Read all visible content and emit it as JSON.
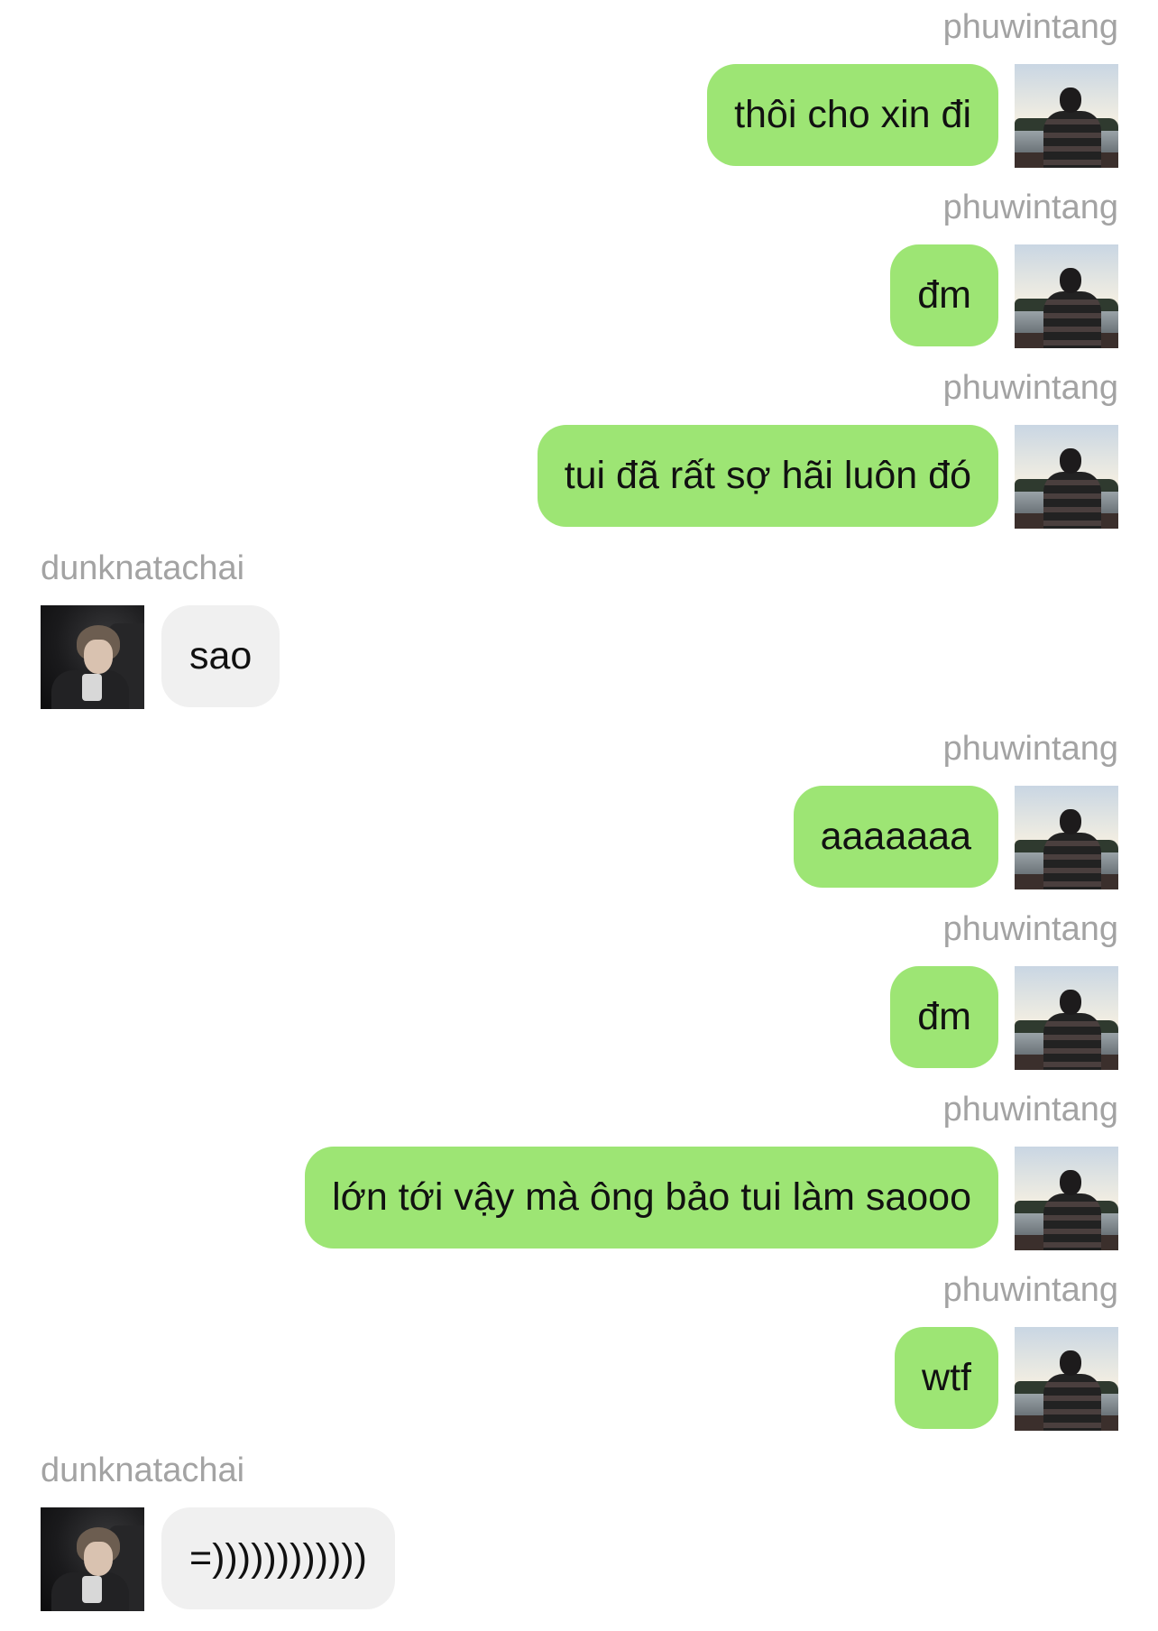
{
  "messages": [
    {
      "side": "right",
      "sender": "phuwintang",
      "text": "thôi cho xin đi"
    },
    {
      "side": "right",
      "sender": "phuwintang",
      "text": "đm"
    },
    {
      "side": "right",
      "sender": "phuwintang",
      "text": "tui đã rất sợ hãi luôn đó"
    },
    {
      "side": "left",
      "sender": "dunknatachai",
      "text": "sao"
    },
    {
      "side": "right",
      "sender": "phuwintang",
      "text": "aaaaaaa"
    },
    {
      "side": "right",
      "sender": "phuwintang",
      "text": "đm"
    },
    {
      "side": "right",
      "sender": "phuwintang",
      "text": "lớn tới vậy mà ông bảo tui làm saooo"
    },
    {
      "side": "right",
      "sender": "phuwintang",
      "text": "wtf"
    },
    {
      "side": "left",
      "sender": "dunknatachai",
      "text": "=))))))))))))"
    }
  ],
  "colors": {
    "own_bubble": "#9de574",
    "other_bubble": "#f0f0f0",
    "username": "#a3a3a3"
  },
  "icons": {
    "own_avatar": "phuwintang-avatar-photo",
    "other_avatar": "dunknatachai-avatar-photo"
  }
}
